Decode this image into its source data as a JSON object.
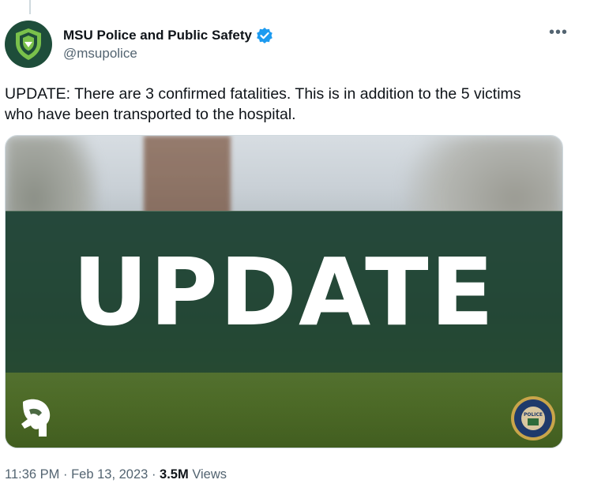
{
  "author": {
    "display_name": "MSU Police and Public Safety",
    "handle": "@msupolice",
    "verified": true,
    "avatar_icon": "shield-icon"
  },
  "menu": {
    "more_label": "•••"
  },
  "tweet": {
    "text": "UPDATE: There are 3 confirmed fatalities. This is in addition to the 5 victims who have been transported to the hospital."
  },
  "media": {
    "overlay_text": "UPDATE",
    "logo_left": "spartan-helmet-icon",
    "logo_right": "police-seal-icon",
    "seal_text": "POLICE"
  },
  "meta": {
    "time": "11:36 PM",
    "separator": "·",
    "date": "Feb 13, 2023",
    "views_count": "3.5M",
    "views_label": "Views"
  },
  "colors": {
    "verified_blue": "#1d9bf0",
    "avatar_bg": "#1e4d3a",
    "band": "#183d32"
  }
}
